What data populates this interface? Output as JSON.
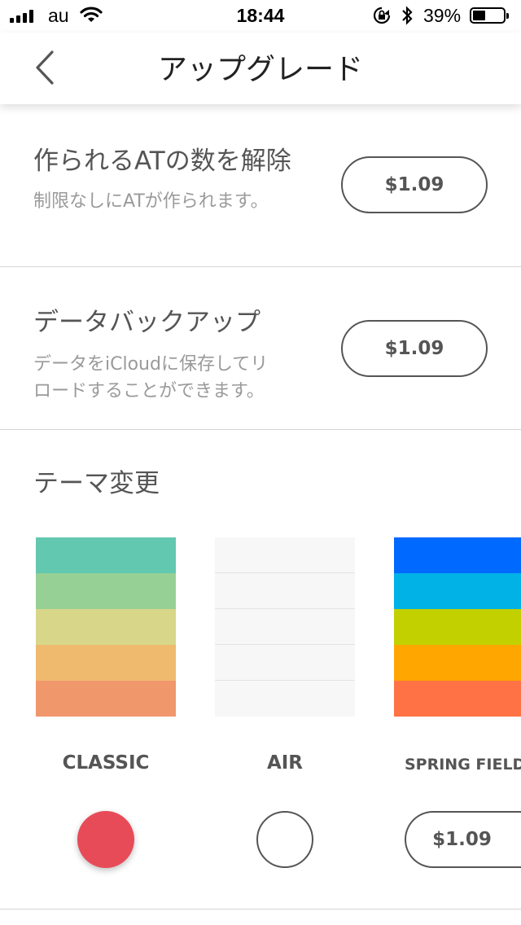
{
  "status_bar": {
    "carrier": "au",
    "time": "18:44",
    "battery": "39%"
  },
  "nav": {
    "title": "アップグレード",
    "back_icon": "chevron-left-icon"
  },
  "upgrades": [
    {
      "title": "作られるATの数を解除",
      "description": "制限なしにATが作られます。",
      "price": "$1.09"
    },
    {
      "title": "データバックアップ",
      "description": "データをiCloudに保存してリロードすることができます。",
      "price": "$1.09"
    }
  ],
  "themes": {
    "section_title": "テーマ変更",
    "items": [
      {
        "name": "CLASSIC",
        "colors": [
          "#62c8b0",
          "#97d095",
          "#d8d689",
          "#efba6d",
          "#f0976c"
        ],
        "state": "selected"
      },
      {
        "name": "AIR",
        "colors": [
          "#f7f7f7",
          "#f7f7f7",
          "#f7f7f7",
          "#f7f7f7",
          "#f7f7f7"
        ],
        "state": "unselected"
      },
      {
        "name": "SPRING FIELD",
        "colors": [
          "#0069ff",
          "#00b2e6",
          "#c3d000",
          "#ffa700",
          "#ff7245"
        ],
        "state": "locked",
        "price": "$1.09"
      }
    ]
  },
  "colors": {
    "selected": "#e84b58",
    "text": "#555555",
    "muted": "#9a9a9a"
  }
}
